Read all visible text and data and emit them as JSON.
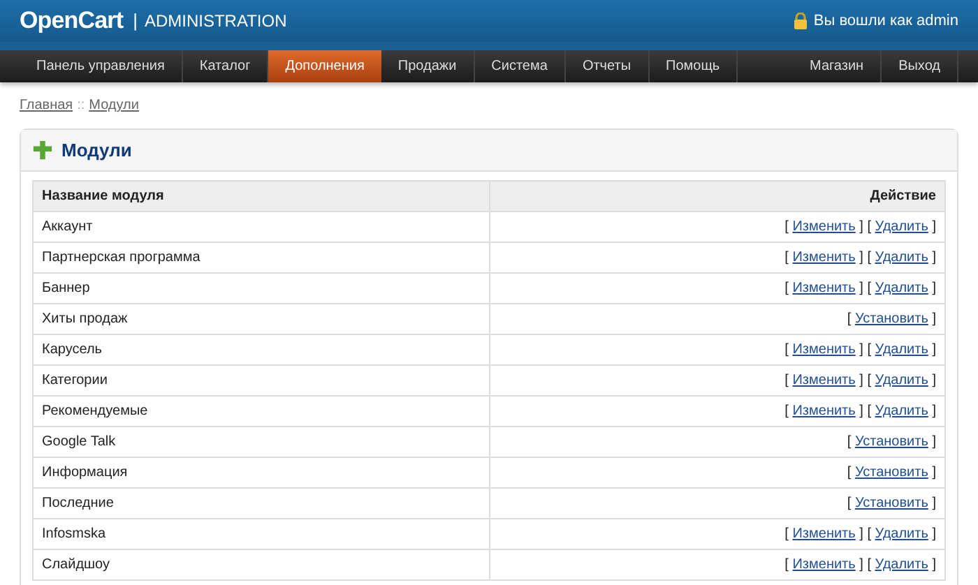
{
  "header": {
    "logo": "OpenCart",
    "separator": "|",
    "subtitle": "ADMINISTRATION",
    "login": "Вы вошли как admin"
  },
  "nav": {
    "left": [
      {
        "label": "Панель управления",
        "selected": false
      },
      {
        "label": "Каталог",
        "selected": false
      },
      {
        "label": "Дополнения",
        "selected": true
      },
      {
        "label": "Продажи",
        "selected": false
      },
      {
        "label": "Система",
        "selected": false
      },
      {
        "label": "Отчеты",
        "selected": false
      },
      {
        "label": "Помощь",
        "selected": false
      }
    ],
    "right": [
      {
        "label": "Магазин",
        "selected": false
      },
      {
        "label": "Выход",
        "selected": false
      }
    ]
  },
  "breadcrumb": [
    {
      "label": "Главная"
    },
    {
      "label": "Модули"
    }
  ],
  "breadcrumb_separator": "::",
  "panel": {
    "title": "Модули"
  },
  "table": {
    "columns": [
      "Название модуля",
      "Действие"
    ],
    "rows": [
      {
        "name": "Аккаунт",
        "actions": [
          {
            "before": "[",
            "label": "Изменить",
            "after": "]"
          },
          {
            "before": "[",
            "label": "Удалить",
            "after": "]"
          }
        ]
      },
      {
        "name": "Партнерская программа",
        "actions": [
          {
            "before": "[",
            "label": "Изменить",
            "after": "]"
          },
          {
            "before": "[",
            "label": "Удалить",
            "after": "]"
          }
        ]
      },
      {
        "name": "Баннер",
        "actions": [
          {
            "before": "[",
            "label": "Изменить",
            "after": "]"
          },
          {
            "before": "[",
            "label": "Удалить",
            "after": "]"
          }
        ]
      },
      {
        "name": "Хиты продаж",
        "actions": [
          {
            "before": "[",
            "label": "Установить",
            "after": "]"
          }
        ]
      },
      {
        "name": "Карусель",
        "actions": [
          {
            "before": "[",
            "label": "Изменить",
            "after": "]"
          },
          {
            "before": "[",
            "label": "Удалить",
            "after": "]"
          }
        ]
      },
      {
        "name": "Категории",
        "actions": [
          {
            "before": "[",
            "label": "Изменить",
            "after": "]"
          },
          {
            "before": "[",
            "label": "Удалить",
            "after": "]"
          }
        ]
      },
      {
        "name": "Рекомендуемые",
        "actions": [
          {
            "before": "[",
            "label": "Изменить",
            "after": "]"
          },
          {
            "before": "[",
            "label": "Удалить",
            "after": "]"
          }
        ]
      },
      {
        "name": "Google Talk",
        "actions": [
          {
            "before": "[",
            "label": "Установить",
            "after": "]"
          }
        ]
      },
      {
        "name": "Информация",
        "actions": [
          {
            "before": "[",
            "label": "Установить",
            "after": "]"
          }
        ]
      },
      {
        "name": "Последние",
        "actions": [
          {
            "before": "[",
            "label": "Установить",
            "after": "]"
          }
        ]
      },
      {
        "name": "Infosmska",
        "actions": [
          {
            "before": "[",
            "label": "Изменить",
            "after": "]"
          },
          {
            "before": "[",
            "label": "Удалить",
            "after": "]"
          }
        ]
      },
      {
        "name": "Слайдшоу",
        "actions": [
          {
            "before": "[",
            "label": "Изменить",
            "after": "]"
          },
          {
            "before": "[",
            "label": "Удалить",
            "after": "]"
          }
        ]
      }
    ]
  }
}
